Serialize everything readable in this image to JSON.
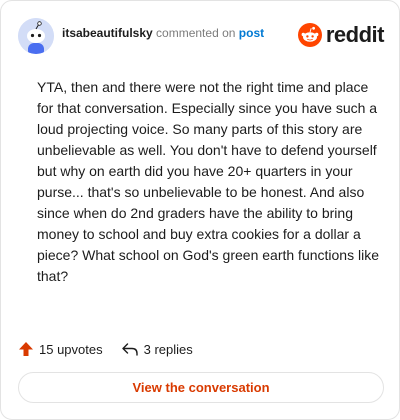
{
  "comment": {
    "username": "itsabeautifulsky",
    "action": "commented on",
    "target_link": "post",
    "body": "YTA, then and there were not the right time and place for that conversation. Especially since you have such a loud projecting voice. So many parts of this story are unbelievable as well. You don't have to defend yourself but why on earth did you have 20+ quarters in your purse... that's so unbelievable to be honest. And also since when do 2nd graders have the ability to bring money to school and buy extra cookies for a dollar a piece? What school on God's green earth functions like that?",
    "upvotes": "15 upvotes",
    "replies": "3 replies"
  },
  "brand": {
    "wordmark": "reddit",
    "color": "#ff4500"
  },
  "cta": {
    "label": "View the conversation",
    "color": "#d93a00"
  },
  "icons": {
    "avatar": "snoo-avatar-icon",
    "logo": "reddit-snoo-icon",
    "upvote": "upvote-arrow-icon",
    "reply": "reply-arrow-icon"
  }
}
